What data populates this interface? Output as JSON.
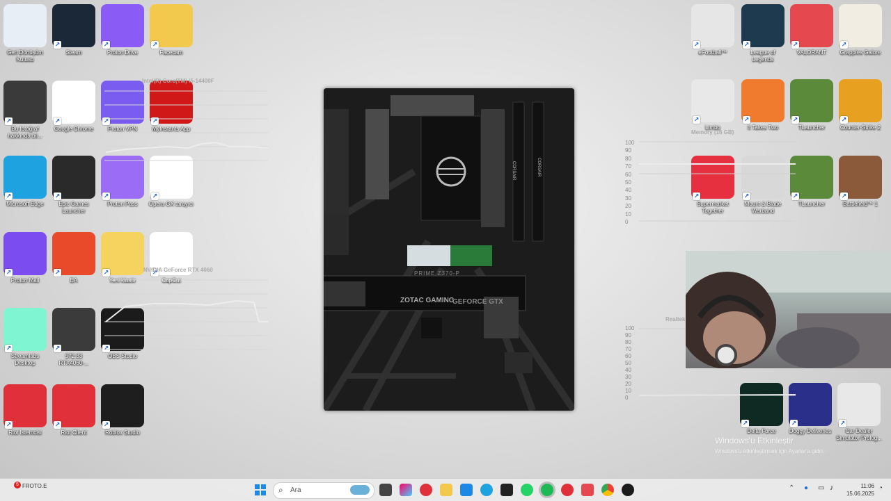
{
  "desktop_icons_left": [
    {
      "name": "recycle-bin-icon",
      "label": "Geri Dönüşüm Kutusu",
      "color": "#e8eef5"
    },
    {
      "name": "steam-icon",
      "label": "Steam",
      "color": "#1b2838"
    },
    {
      "name": "proton-drive-icon",
      "label": "Proton Drive",
      "color": "#8a5cf5"
    },
    {
      "name": "facecam-icon",
      "label": "Facecam",
      "color": "#f2c94c"
    },
    {
      "name": "about-photo-icon",
      "label": "Bu fotoğraf hakkında bil...",
      "color": "#3a3a3a"
    },
    {
      "name": "chrome-icon",
      "label": "Google Chrome",
      "color": "#ffffff"
    },
    {
      "name": "proton-vpn-icon",
      "label": "Proton VPN",
      "color": "#7b5cf0"
    },
    {
      "name": "myinstants-icon",
      "label": "MyInstants App",
      "color": "#d01818"
    },
    {
      "name": "edge-icon",
      "label": "Microsoft Edge",
      "color": "#1fa2e0"
    },
    {
      "name": "epic-games-icon",
      "label": "Epic Games Launcher",
      "color": "#2a2a2a"
    },
    {
      "name": "proton-pass-icon",
      "label": "Proton Pass",
      "color": "#9b6cf5"
    },
    {
      "name": "opera-gx-icon",
      "label": "Opera GX tarayıcı",
      "color": "#ffffff"
    },
    {
      "name": "proton-mail-icon",
      "label": "Proton Mail",
      "color": "#7b4cf0"
    },
    {
      "name": "ea-icon",
      "label": "EA",
      "color": "#e84a2a"
    },
    {
      "name": "new-folder-icon",
      "label": "Yeni klasör",
      "color": "#f6d25e"
    },
    {
      "name": "capcut-icon",
      "label": "CapCut",
      "color": "#ffffff"
    },
    {
      "name": "streamlabs-icon",
      "label": "Streamlabs Desktop",
      "color": "#80f5d2"
    },
    {
      "name": "nvidia-driver-icon",
      "label": "572.83 RTX4060-...",
      "color": "#3b3b3b"
    },
    {
      "name": "obs-icon",
      "label": "OBS Studio",
      "color": "#1b1b1b"
    },
    {
      "name": "riot-client-icon-1",
      "label": "Riot İstemcisi",
      "color": "#e0303a"
    },
    {
      "name": "riot-client-icon-2",
      "label": "Riot Client",
      "color": "#e0303a"
    },
    {
      "name": "roblox-studio-icon",
      "label": "Roblox Studio",
      "color": "#1e1e1e"
    }
  ],
  "desktop_icons_right": [
    {
      "name": "efootball-icon",
      "label": "eFootball™",
      "color": "#e6e6e6"
    },
    {
      "name": "league-of-legends-icon",
      "label": "League of Legends",
      "color": "#1d3a4f"
    },
    {
      "name": "valorant-icon",
      "label": "VALORANT",
      "color": "#e6484f"
    },
    {
      "name": "grapples-galore-icon",
      "label": "Grapples Galore",
      "color": "#f1ede2"
    },
    {
      "name": "limbo-icon",
      "label": "Limbo",
      "color": "#e8e8e8"
    },
    {
      "name": "it-takes-two-icon",
      "label": "It Takes Two",
      "color": "#f07a2e"
    },
    {
      "name": "tlauncher-icon-1",
      "label": "TLauncher",
      "color": "#5a8a3a"
    },
    {
      "name": "counter-strike-icon",
      "label": "Counter-Strike 2",
      "color": "#e8a020"
    },
    {
      "name": "supermarket-icon",
      "label": "Supermarket Together",
      "color": "#e63040"
    },
    {
      "name": "mount-blade-icon",
      "label": "Mount & Blade Warband",
      "color": "#d8d8d8"
    },
    {
      "name": "tlauncher-icon-2",
      "label": "TLauncher",
      "color": "#5a8a3a"
    },
    {
      "name": "battlefield-icon",
      "label": "Battlefield™ 1",
      "color": "#8a5a3a"
    },
    {
      "name": "delta-force-icon",
      "label": "Delta Force",
      "color": "#0e2a22"
    },
    {
      "name": "doggy-deliveries-icon",
      "label": "Doggy Deliveries",
      "color": "#2a2f8a"
    },
    {
      "name": "car-dealer-icon",
      "label": "Car Dealer Simulator Prolog...",
      "color": "#e8e8e8"
    }
  ],
  "graphs": {
    "cpu_title": "Intel(R) Core(TM) i5-14400F",
    "gpu_title": "NVIDIA GeForce RTX 4060",
    "memory_title": "Memory (16 GB)",
    "realtek_title": "Realtek",
    "axis": [
      "100",
      "90",
      "80",
      "70",
      "60",
      "50",
      "40",
      "30",
      "20",
      "10",
      "0"
    ]
  },
  "watermark": {
    "line1": "Windows'u Etkinleştir",
    "line2": "Windows'u etkinleştirmek için Ayarlar'a gidin."
  },
  "taskbar": {
    "search_placeholder": "Ara",
    "time": "11:06",
    "date": "15.06.2025",
    "weather_label": "FROTO.E",
    "weather_badge": "5"
  },
  "mobo": {
    "board_name": "PRIME Z370-P",
    "gpu_brand": "ZOTAC GAMING",
    "gpu_model": "GEFORCE GTX",
    "ram_brand": "CORSAIR"
  }
}
